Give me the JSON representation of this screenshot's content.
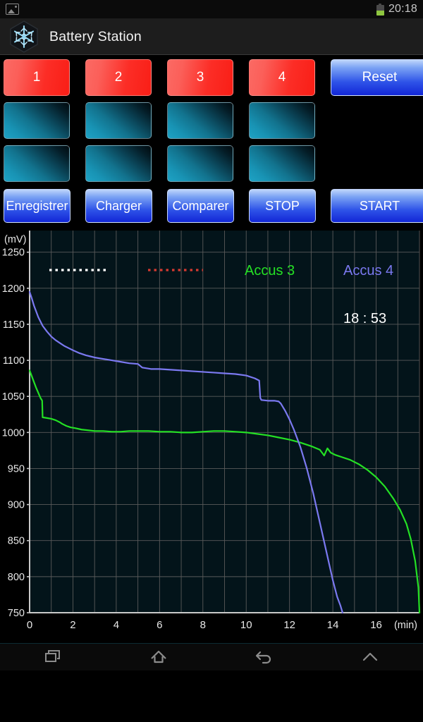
{
  "statusbar": {
    "screenshot_icon": "image-icon",
    "battery_icon": "battery-icon",
    "time": "20:18"
  },
  "titlebar": {
    "icon": "snowflake-icon",
    "title": "Battery Station"
  },
  "slots": {
    "row_numbers": [
      "1",
      "2",
      "3",
      "4"
    ],
    "reset_label": "Reset"
  },
  "actions": [
    {
      "label": "Enregistrer",
      "name": "save-button"
    },
    {
      "label": "Charger",
      "name": "load-button"
    },
    {
      "label": "Comparer",
      "name": "compare-button"
    },
    {
      "label": "STOP",
      "name": "stop-button"
    },
    {
      "label": "START",
      "name": "start-button"
    }
  ],
  "chart_overlay": {
    "timer": "18 : 53"
  },
  "navbar": {
    "recents": "recents-icon",
    "home": "home-icon",
    "back": "back-icon",
    "expand": "chevron-up-icon"
  },
  "chart_data": {
    "type": "line",
    "title": "",
    "xlabel": "(min)",
    "ylabel": "(mV)",
    "xlim": [
      0,
      18
    ],
    "ylim": [
      750,
      1280
    ],
    "yticks": [
      750,
      800,
      850,
      900,
      950,
      1000,
      1050,
      1100,
      1150,
      1200,
      1250
    ],
    "xticks": [
      0,
      2,
      4,
      6,
      8,
      10,
      12,
      14,
      16
    ],
    "grid": true,
    "grid_minor_x_step": 1,
    "legend_position": "top",
    "legend": [
      {
        "label": "",
        "style": "dotted",
        "color": "#ffffff",
        "name": "accus-1"
      },
      {
        "label": "",
        "style": "dotted",
        "color": "#d63a30",
        "name": "accus-2"
      },
      {
        "label": "Accus 3",
        "style": "solid",
        "color": "#24e024",
        "name": "accus-3"
      },
      {
        "label": "Accus 4",
        "style": "solid",
        "color": "#7b79f0",
        "name": "accus-4"
      }
    ],
    "series": [
      {
        "name": "Accus 3",
        "color": "#24e024",
        "x": [
          0.0,
          0.1,
          0.2,
          0.3,
          0.4,
          0.5,
          0.58,
          0.6,
          0.8,
          1.0,
          1.2,
          1.4,
          1.5,
          1.7,
          1.9,
          2.1,
          2.4,
          2.7,
          3.0,
          3.4,
          3.8,
          4.2,
          4.6,
          5.0,
          5.5,
          6.0,
          6.5,
          7.0,
          7.5,
          8.0,
          8.5,
          9.0,
          9.5,
          10.0,
          10.5,
          11.0,
          11.5,
          12.0,
          12.5,
          13.0,
          13.4,
          13.6,
          13.75,
          13.9,
          14.1,
          14.4,
          14.8,
          15.2,
          15.6,
          16.0,
          16.4,
          16.8,
          17.1,
          17.4,
          17.6,
          17.8,
          17.95,
          18.0
        ],
        "y": [
          1086,
          1078,
          1070,
          1062,
          1055,
          1048,
          1044,
          1021,
          1020,
          1019,
          1017,
          1014,
          1012,
          1009,
          1007,
          1006,
          1004,
          1003,
          1002,
          1002,
          1001,
          1001,
          1002,
          1002,
          1002,
          1001,
          1001,
          1000,
          1000,
          1001,
          1002,
          1002,
          1001,
          1000,
          998,
          996,
          993,
          990,
          986,
          981,
          976,
          968,
          978,
          972,
          969,
          966,
          962,
          956,
          948,
          938,
          925,
          908,
          893,
          873,
          852,
          822,
          785,
          750
        ]
      },
      {
        "name": "Accus 4",
        "color": "#7b79f0",
        "x": [
          0.0,
          0.1,
          0.2,
          0.3,
          0.4,
          0.5,
          0.6,
          0.8,
          1.0,
          1.2,
          1.4,
          1.6,
          1.8,
          2.0,
          2.3,
          2.6,
          3.0,
          3.4,
          3.8,
          4.2,
          4.6,
          5.0,
          5.2,
          5.4,
          5.6,
          6.0,
          6.5,
          7.0,
          7.5,
          8.0,
          8.5,
          9.0,
          9.5,
          10.0,
          10.4,
          10.6,
          10.65,
          10.7,
          11.0,
          11.3,
          11.5,
          11.6,
          11.8,
          12.0,
          12.2,
          12.5,
          12.8,
          13.1,
          13.4,
          13.7,
          14.0,
          14.2,
          14.35,
          14.45
        ],
        "y": [
          1195,
          1186,
          1176,
          1168,
          1160,
          1154,
          1148,
          1140,
          1133,
          1128,
          1124,
          1120,
          1117,
          1114,
          1110,
          1107,
          1104,
          1102,
          1100,
          1098,
          1096,
          1095,
          1090,
          1089,
          1088,
          1088,
          1087,
          1086,
          1085,
          1084,
          1083,
          1082,
          1081,
          1079,
          1075,
          1072,
          1048,
          1045,
          1044,
          1044,
          1043,
          1040,
          1030,
          1018,
          1004,
          980,
          950,
          915,
          875,
          835,
          795,
          772,
          760,
          750
        ]
      }
    ]
  }
}
